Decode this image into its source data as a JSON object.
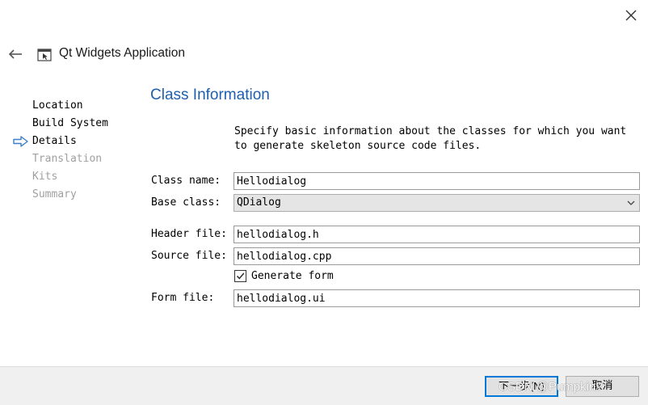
{
  "window": {
    "close_icon": "close-icon"
  },
  "header": {
    "back_icon": "arrow-left-icon",
    "app_icon": "qt-application-icon",
    "title": "Qt Widgets Application"
  },
  "steps": [
    {
      "label": "Location",
      "state": "done"
    },
    {
      "label": "Build System",
      "state": "done"
    },
    {
      "label": "Details",
      "state": "current"
    },
    {
      "label": "Translation",
      "state": "disabled"
    },
    {
      "label": "Kits",
      "state": "disabled"
    },
    {
      "label": "Summary",
      "state": "disabled"
    }
  ],
  "page": {
    "title": "Class Information",
    "description": "Specify basic information about the classes for which you want to generate skeleton source code files."
  },
  "form": {
    "class_name_label": "Class name:",
    "class_name_value": "Hellodialog",
    "base_class_label": "Base class:",
    "base_class_value": "QDialog",
    "header_file_label": "Header file:",
    "header_file_value": "hellodialog.h",
    "source_file_label": "Source file:",
    "source_file_value": "hellodialog.cpp",
    "generate_form_label": "Generate form",
    "generate_form_checked": true,
    "form_file_label": "Form file:",
    "form_file_value": "hellodialog.ui"
  },
  "footer": {
    "next_label": "下一步(N)",
    "cancel_label": "取消"
  },
  "watermark": "CSDN @Pumpkin?",
  "colors": {
    "accent": "#0078d7",
    "title_blue": "#1f5fb0",
    "step_arrow": "#3c7fc8",
    "disabled_text": "#a0a0a0",
    "footer_bg": "#f0f0f0"
  }
}
